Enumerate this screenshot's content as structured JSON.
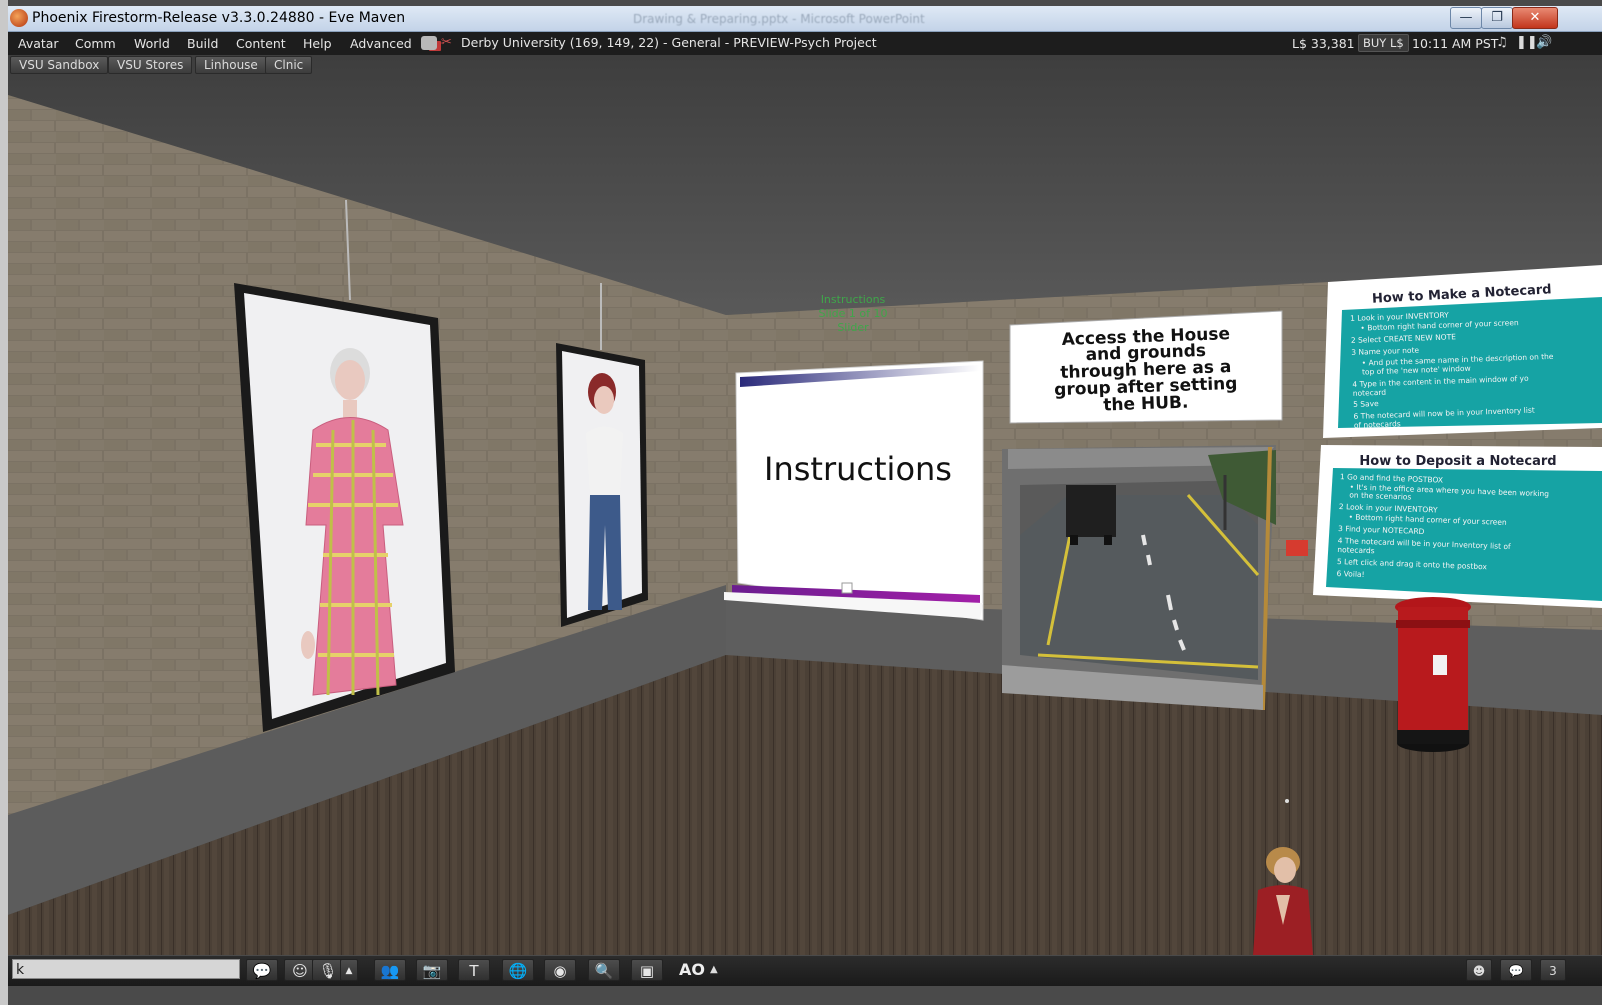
{
  "window": {
    "title": "Phoenix Firestorm-Release v3.3.0.24880 - Eve Maven",
    "background_title": "Drawing & Preparing.pptx - Microsoft PowerPoint",
    "controls": {
      "minimize": "—",
      "maximize": "❐",
      "close": "✕"
    }
  },
  "menubar": {
    "items": [
      "Avatar",
      "Comm",
      "World",
      "Build",
      "Content",
      "Help",
      "Advanced"
    ],
    "location": "Derby University (169, 149, 22) - General - PREVIEW-Psych Project",
    "balance": "L$ 33,381",
    "buy_label": "BUY L$",
    "time": "10:11 AM PST"
  },
  "favorites": [
    "VSU Sandbox",
    "VSU Stores",
    "Linhouse",
    "Clnic"
  ],
  "scene": {
    "floating_text": [
      "Instructions",
      "Slide 1 of 10",
      "Slider"
    ],
    "slide_title": "Instructions",
    "sign_access": [
      "Access the House",
      "and grounds",
      "through here as a",
      "group after setting",
      "the HUB."
    ],
    "notecard_make": {
      "title": "How to Make a Notecard",
      "lines": [
        "1  Look in your INVENTORY",
        "•  Bottom right hand corner of your screen",
        "2  Select CREATE NEW NOTE",
        "3  Name your note",
        "•  And put the same name in the description on the",
        "   top of the 'new note' window",
        "4  Type in the content in the main window of yo",
        "   notecard",
        "5  Save",
        "6  The notecard will now be in your Inventory list",
        "   of notecards"
      ]
    },
    "notecard_deposit": {
      "title": "How to Deposit a Notecard",
      "lines": [
        "1  Go and find the POSTBOX",
        "•  It's in the office area where you have been working",
        "   on the scenarios",
        "2  Look in your INVENTORY",
        "•  Bottom right hand corner of your screen",
        "3  Find your NOTECARD",
        "4  The notecard will be in your Inventory list of",
        "   notecards",
        "5  Left click and drag it onto the postbox",
        "6  Voila!"
      ]
    }
  },
  "bottombar": {
    "chat_value": "k",
    "ao_label": "AO",
    "notification_count": "3"
  }
}
